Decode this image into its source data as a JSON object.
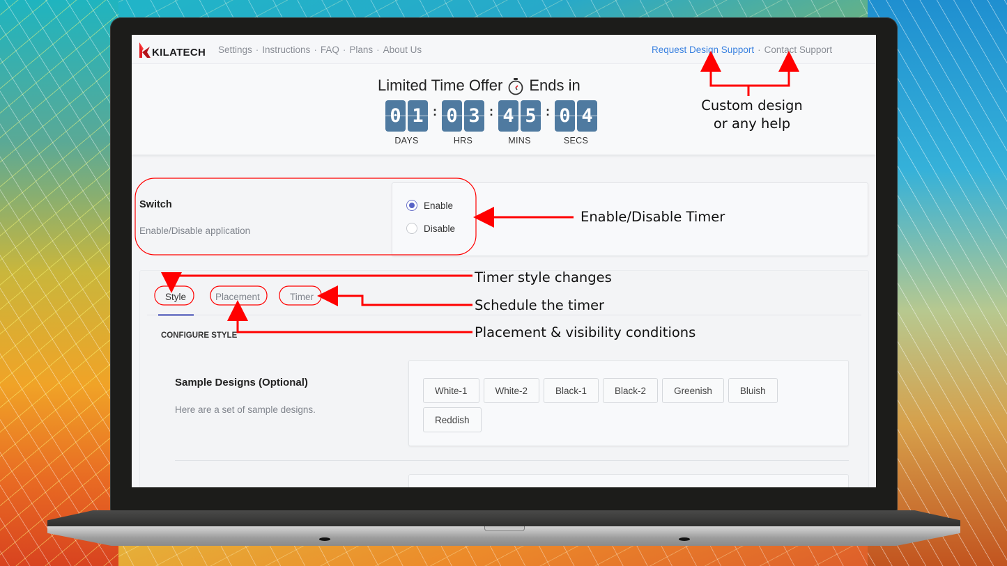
{
  "app": {
    "brand": "KILATECH",
    "brand_color": "#e31e24"
  },
  "nav": {
    "links": [
      "Settings",
      "Instructions",
      "FAQ",
      "Plans",
      "About Us"
    ],
    "separator": "·",
    "request_design_support": "Request Design Support",
    "contact_support": "Contact Support",
    "link_color": "#3b82e0"
  },
  "offer": {
    "title_before": "Limited Time Offer",
    "title_after": "Ends in",
    "icon": "stopwatch-icon",
    "days": [
      "0",
      "1"
    ],
    "hours": [
      "0",
      "3"
    ],
    "minutes": [
      "4",
      "5"
    ],
    "seconds": [
      "0",
      "4"
    ],
    "labels": {
      "days": "DAYS",
      "hours": "HRS",
      "minutes": "MINS",
      "seconds": "SECS"
    },
    "separator": ":",
    "digit_color": "#4f7aa0"
  },
  "switch": {
    "title": "Switch",
    "description": "Enable/Disable application",
    "options": [
      {
        "label": "Enable",
        "selected": true
      },
      {
        "label": "Disable",
        "selected": false
      }
    ],
    "accent": "#5762c6"
  },
  "tabs": [
    {
      "label": "Style",
      "active": true
    },
    {
      "label": "Placement",
      "active": false
    },
    {
      "label": "Timer",
      "active": false
    }
  ],
  "configure": {
    "heading": "CONFIGURE STYLE",
    "sample_designs": {
      "title": "Sample Designs (Optional)",
      "description": "Here are a set of sample designs.",
      "buttons": [
        "White-1",
        "White-2",
        "Black-1",
        "Black-2",
        "Greenish",
        "Bluish",
        "Reddish"
      ]
    }
  },
  "annotations": {
    "support": [
      "Custom design",
      "or any help"
    ],
    "switch": "Enable/Disable Timer",
    "style_tab": "Timer style changes",
    "timer_tab": "Schedule the timer",
    "placement_tab": "Placement & visibility conditions",
    "color": "#ff0000"
  }
}
